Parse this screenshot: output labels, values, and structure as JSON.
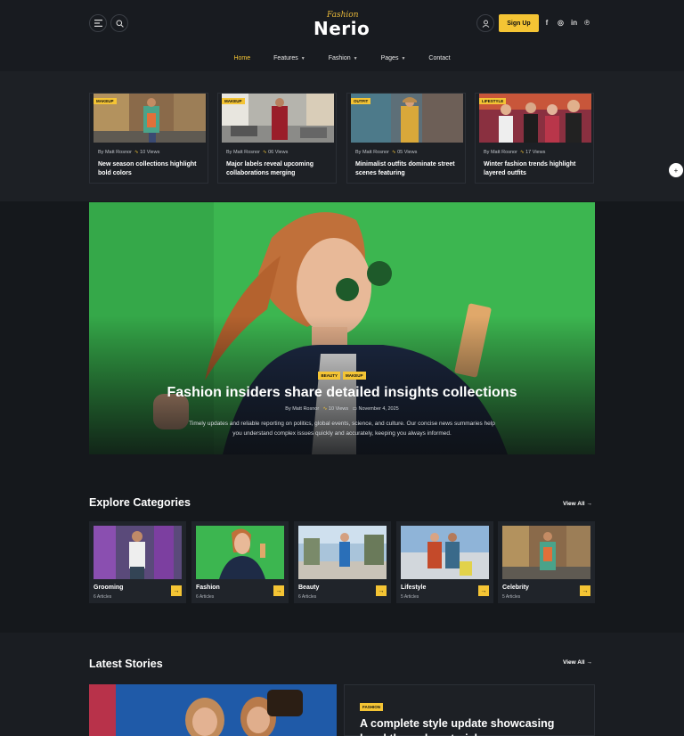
{
  "header": {
    "logo_script": "Fashion",
    "logo_main": "Nerio",
    "signup_label": "Sign Up",
    "socials": [
      "f",
      "◎",
      "in",
      "℗"
    ]
  },
  "nav": [
    {
      "label": "Home",
      "active": true,
      "dropdown": false
    },
    {
      "label": "Features",
      "active": false,
      "dropdown": true
    },
    {
      "label": "Fashion",
      "active": false,
      "dropdown": true
    },
    {
      "label": "Pages",
      "active": false,
      "dropdown": true
    },
    {
      "label": "Contact",
      "active": false,
      "dropdown": false
    }
  ],
  "top_cards": [
    {
      "tag": "MAKEUP",
      "author": "By Matt Rosnor",
      "views": "10 Views",
      "title": "New season collections highlight bold colors"
    },
    {
      "tag": "MAKEUP",
      "author": "By Matt Rosnor",
      "views": "06 Views",
      "title": "Major labels reveal upcoming collaborations merging"
    },
    {
      "tag": "OUTFIT",
      "author": "By Matt Rosnor",
      "views": "05 Views",
      "title": "Minimalist outfits dominate street scenes featuring"
    },
    {
      "tag": "LIFESTYLE",
      "author": "By Matt Rosnor",
      "views": "17 Views",
      "title": "Winter fashion trends highlight layered outfits"
    }
  ],
  "hero": {
    "tags": [
      "BEAUTY",
      "MAKEUP"
    ],
    "title": "Fashion insiders share detailed insights collections",
    "author": "By Matt Rosnor",
    "views": "10 Views",
    "date": "November 4, 2025",
    "description": "Timely updates and reliable reporting on politics, global events, science, and culture. Our concise news summaries help you understand complex issues quickly and accurately, keeping you always informed."
  },
  "categories": {
    "title": "Explore Categories",
    "view_all": "View All",
    "items": [
      {
        "name": "Grooming",
        "count": "6 Articles"
      },
      {
        "name": "Fashion",
        "count": "6 Articles"
      },
      {
        "name": "Beauty",
        "count": "6 Articles"
      },
      {
        "name": "Lifestyle",
        "count": "5 Articles"
      },
      {
        "name": "Celebrity",
        "count": "5 Articles"
      }
    ]
  },
  "latest": {
    "title": "Latest Stories",
    "view_all": "View All",
    "tag": "FASHION",
    "story_title": "A complete style update showcasing breakthrough materials"
  },
  "colors": {
    "accent": "#f4c434",
    "background": "#15181c",
    "hero_green": "#38b04e"
  }
}
